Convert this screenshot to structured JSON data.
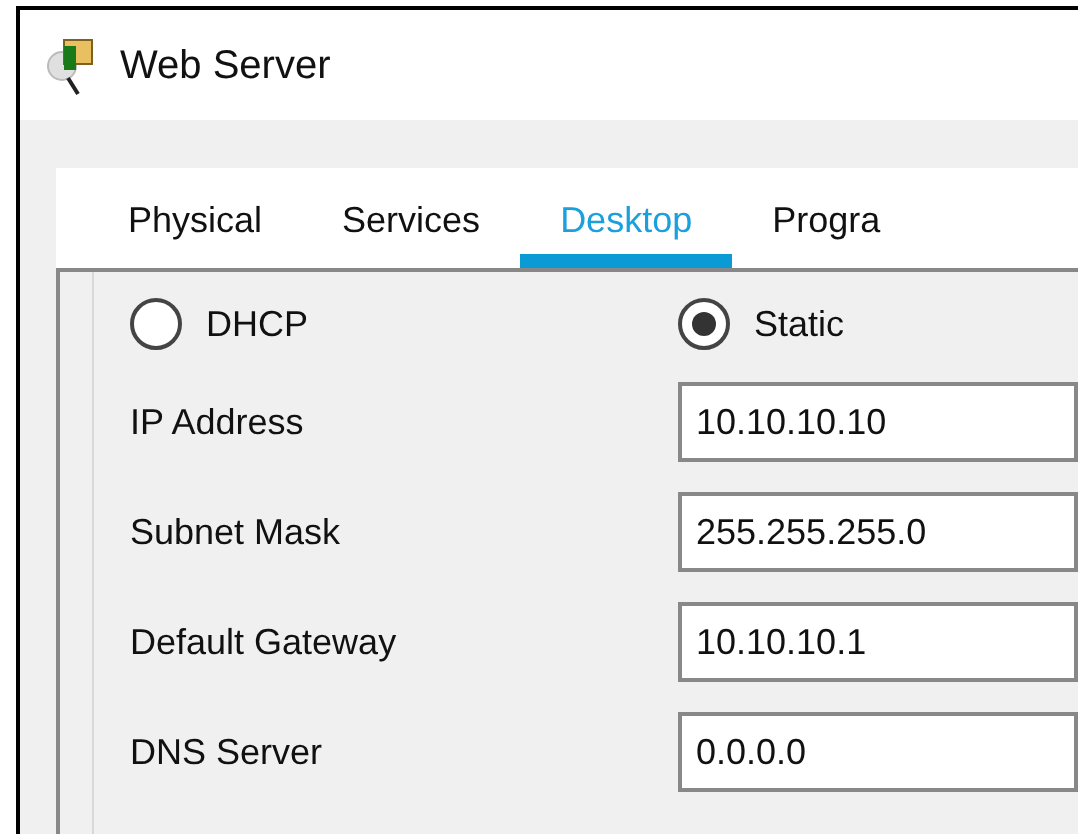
{
  "window": {
    "title": "Web Server"
  },
  "tabs": [
    {
      "label": "Physical",
      "selected": false
    },
    {
      "label": "Services",
      "selected": false
    },
    {
      "label": "Desktop",
      "selected": true
    },
    {
      "label": "Progra",
      "selected": false
    }
  ],
  "ip_mode": [
    {
      "label": "DHCP",
      "selected": false
    },
    {
      "label": "Static",
      "selected": true
    }
  ],
  "fields": [
    {
      "label": "IP Address",
      "value": "10.10.10.10"
    },
    {
      "label": "Subnet Mask",
      "value": "255.255.255.0"
    },
    {
      "label": "Default Gateway",
      "value": "10.10.10.1"
    },
    {
      "label": "DNS Server",
      "value": "0.0.0.0"
    }
  ]
}
